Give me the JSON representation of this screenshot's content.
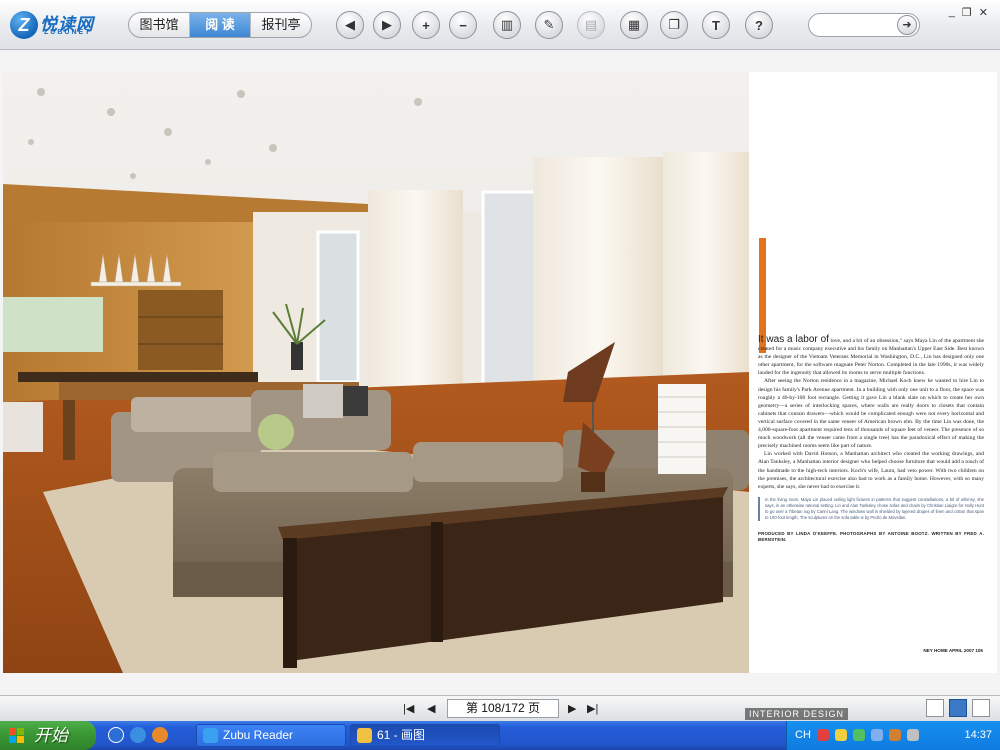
{
  "app": {
    "logo_text": "悦读网",
    "logo_sub": "ZUBUNET"
  },
  "toolbar": {
    "tabs": [
      {
        "label": "图书馆",
        "active": false
      },
      {
        "label": "阅 读",
        "active": true
      },
      {
        "label": "报刊亭",
        "active": false
      }
    ],
    "buttons": [
      {
        "name": "previous-page-button",
        "icon": "◀",
        "disabled": false
      },
      {
        "name": "next-page-button",
        "icon": "▶",
        "disabled": false
      },
      {
        "name": "zoom-in-button",
        "icon": "+",
        "disabled": false
      },
      {
        "name": "zoom-out-button",
        "icon": "−",
        "disabled": false
      },
      {
        "name": "bookshelf-button",
        "icon": "▥",
        "disabled": false
      },
      {
        "name": "annotate-button",
        "icon": "✎",
        "disabled": false
      },
      {
        "name": "print-button",
        "icon": "▤",
        "disabled": true
      },
      {
        "name": "save-button",
        "icon": "▦",
        "disabled": false
      },
      {
        "name": "copy-button",
        "icon": "❐",
        "disabled": false
      },
      {
        "name": "text-button",
        "icon": "T",
        "disabled": false
      },
      {
        "name": "help-button",
        "icon": "?",
        "disabled": false
      }
    ],
    "search_placeholder": "",
    "search_go_icon": "➜"
  },
  "window_controls": {
    "minimize": "_",
    "restore": "❐",
    "close": "✕"
  },
  "article": {
    "dropcap": "It was a labor of",
    "paragraphs": [
      "love, and a bit of an obsession,\" says Maya Lin of the apartment she created for a music company executive and his family on Manhattan's Upper East Side. Best known as the designer of the Vietnam Veterans Memorial in Washington, D.C., Lin has designed only one other apartment, for the software magnate Peter Norton. Completed in the late 1990s, it was widely lauded for the ingenuity that allowed its rooms to serve multiple functions.",
      "After seeing the Norton residence in a magazine, Michael Koch knew he wanted to hire Lin to design his family's Park Avenue apartment. In a building with only one unit to a floor, the space was roughly a 40-by-100 foot rectangle. Getting it gave Lin a blank slate on which to create her own geometry—a series of interlocking spaces, where walls are really doors to closets that contain cabinets that contain drawers—which would be complicated enough were not every horizontal and vertical surface covered in the same veneer of American brown elm. By the time Lin was done, the 4,000-square-foot apartment required tens of thousands of square feet of veneer. The presence of so much woodwork (all the veneer came from a single tree) has the paradoxical effect of making the precisely machined rooms seem like part of nature.",
      "Lin worked with David Hotson, a Manhattan architect who created the working drawings, and Alan Tanksley, a Manhattan interior designer who helped choose furniture that would add a touch of the handmade to the high-tech interiors. Koch's wife, Laura, had veto power. With two children on the premises, the architectural exercise also had to work as a family home. However, with so many experts, she says, she never had to exercise it."
    ],
    "caption": "In the living room, Maya Lin placed ceiling light fixtures in patterns that suggest constellations, a bit of whimsy, she says, in an otherwise rational setting. Lin and Alan Tanksley chose sofas and chairs by Christian Liaigre for Holly Hunt to go over a Tibetan rug by Carini Lang. The windows wall is shielded by layered drapes of linen and cotton that span to 100-foot length. The sculptures on the sofa table is by Pedro de Movellan.",
    "credit": "PRODUCED BY LINDA O'KEEFFE. PHOTOGRAPHS BY ANTOINE BOOTZ. WRITTEN BY FRED A. BERNSTEIN.",
    "folio": "NEY HOME APRIL 2007 105"
  },
  "pagenav": {
    "first": "|◀",
    "prev": "◀",
    "page_text": "第 108/172 页",
    "next": "▶",
    "last": "▶|",
    "watermark": "INTERIOR DESIGN"
  },
  "taskbar": {
    "start_label": "开始",
    "tasks": [
      {
        "label": "Zubu Reader",
        "active": false
      },
      {
        "label": "61 - 画图",
        "active": true
      }
    ],
    "tray_lang": "CH",
    "clock": "14:37"
  }
}
